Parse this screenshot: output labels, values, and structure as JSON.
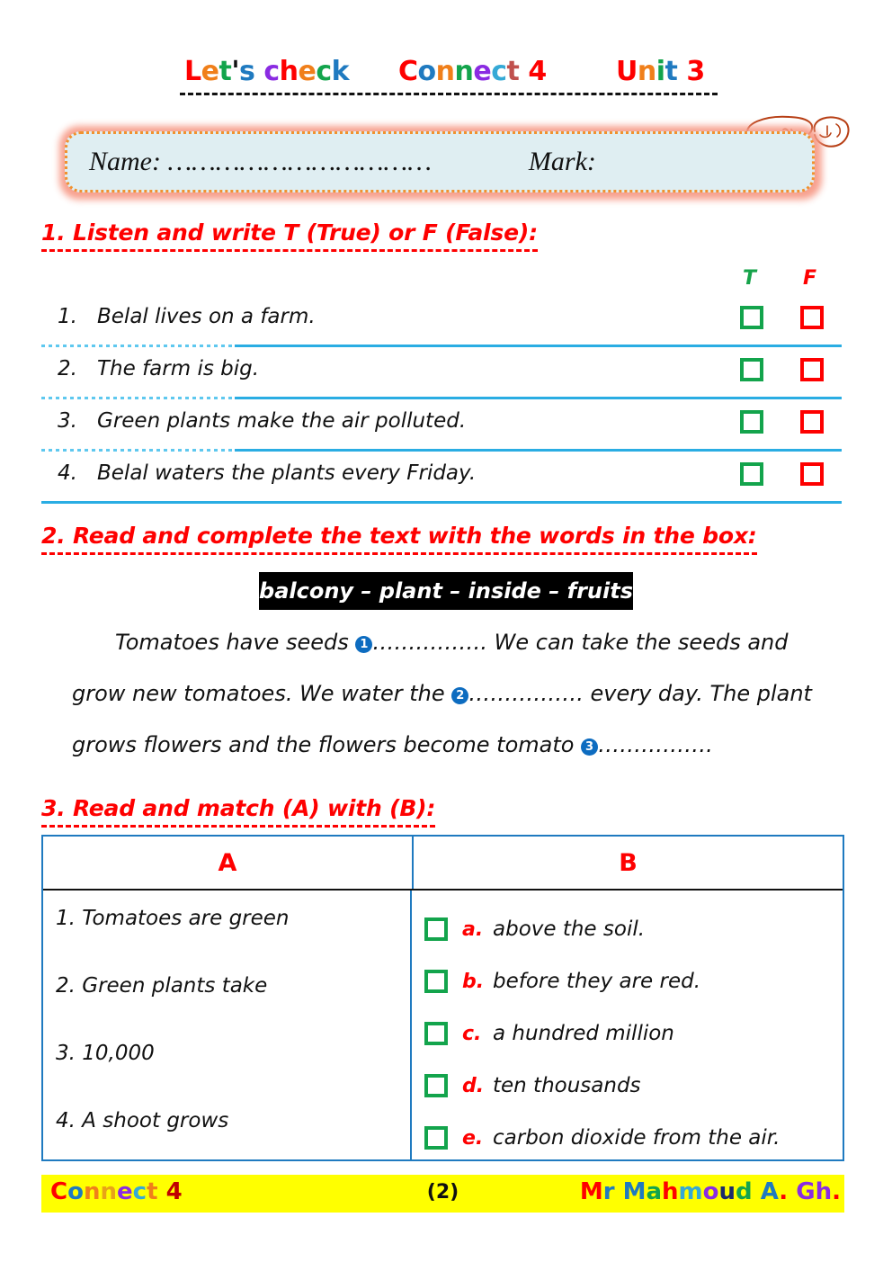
{
  "header": {
    "titles": [
      {
        "text": "Let's check",
        "letters": [
          {
            "c": "L",
            "color": "#fe0000"
          },
          {
            "c": "e",
            "color": "#f07f1a"
          },
          {
            "c": "t",
            "color": "#13a44c"
          },
          {
            "c": "'",
            "color": "#111111"
          },
          {
            "c": "s",
            "color": "#1f7ac0"
          },
          {
            "c": " ",
            "color": "#111111"
          },
          {
            "c": "c",
            "color": "#8a2be2"
          },
          {
            "c": "h",
            "color": "#fe0000"
          },
          {
            "c": "e",
            "color": "#f07f1a"
          },
          {
            "c": "c",
            "color": "#13a44c"
          },
          {
            "c": "k",
            "color": "#1f7ac0"
          }
        ]
      },
      {
        "text": "Connect 4",
        "letters": [
          {
            "c": "C",
            "color": "#fe0000"
          },
          {
            "c": "o",
            "color": "#1f7ac0"
          },
          {
            "c": "n",
            "color": "#f07f1a"
          },
          {
            "c": "n",
            "color": "#13a44c"
          },
          {
            "c": "e",
            "color": "#8a2be2"
          },
          {
            "c": "c",
            "color": "#35a9d6"
          },
          {
            "c": "t",
            "color": "#c0504d"
          },
          {
            "c": " ",
            "color": "#111111"
          },
          {
            "c": "4",
            "color": "#fe0000"
          }
        ]
      },
      {
        "text": "Unit 3",
        "letters": [
          {
            "c": "U",
            "color": "#fe0000"
          },
          {
            "c": "n",
            "color": "#f07f1a"
          },
          {
            "c": "i",
            "color": "#13a44c"
          },
          {
            "c": "t",
            "color": "#1f7ac0"
          },
          {
            "c": " ",
            "color": "#111111"
          },
          {
            "c": "3",
            "color": "#fe0000"
          }
        ]
      }
    ],
    "signature_label": "Arabic teacher signature"
  },
  "name_box": {
    "name_label": "Name: ……………………………",
    "mark_label": "Mark:",
    "fill_color": "#dfeef2",
    "border_color": "#f0922f",
    "glow_color": "#f79b88"
  },
  "section1": {
    "heading": "1. Listen and write T (True) or F (False):",
    "col_true": "T",
    "col_false": "F",
    "true_color": "#16a34a",
    "false_color": "#fe0000",
    "items": [
      {
        "num": "1.",
        "text": "Belal lives on a farm."
      },
      {
        "num": "2.",
        "text": "The farm is big."
      },
      {
        "num": "3.",
        "text": "Green plants make the air polluted."
      },
      {
        "num": "4.",
        "text": "Belal waters the plants every Friday."
      }
    ]
  },
  "section2": {
    "heading": "2. Read and complete the text with the words in the box:",
    "word_box": "balcony – plant – inside – fruits",
    "word_box_words": [
      "balcony",
      "plant",
      "inside",
      "fruits"
    ],
    "paragraph_parts": {
      "p1": "Tomatoes have seeds ",
      "n1": "1",
      "p2": "……………. We can take the seeds and grow new tomatoes. We water the ",
      "n2": "2",
      "p3": "……………. every day. The plant grows flowers and the flowers become tomato ",
      "n3": "3",
      "p4": "……………."
    },
    "bullet_color": "#0d6cc0"
  },
  "section3": {
    "heading": "3. Read and match (A) with (B):",
    "col_a_header": "A",
    "col_b_header": "B",
    "col_a_items": [
      "1. Tomatoes are green",
      "2. Green plants take",
      "3. 10,000",
      "4. A shoot grows"
    ],
    "col_b_items": [
      {
        "letter": "a.",
        "text": "above the soil."
      },
      {
        "letter": "b.",
        "text": "before they are red."
      },
      {
        "letter": "c.",
        "text": "a hundred million"
      },
      {
        "letter": "d.",
        "text": "ten thousands"
      },
      {
        "letter": "e.",
        "text": "carbon dioxide from the air."
      }
    ],
    "checkbox_color": "#13a44c",
    "table_border_color": "#1f7ac0"
  },
  "footer": {
    "background": "#ffff00",
    "page_number": "(2)",
    "left": {
      "text": "Connect 4",
      "letters": [
        {
          "c": "C",
          "color": "#fe0000"
        },
        {
          "c": "o",
          "color": "#1f7ac0"
        },
        {
          "c": "n",
          "color": "#f07f1a"
        },
        {
          "c": "n",
          "color": "#e8a317"
        },
        {
          "c": "e",
          "color": "#8a2be2"
        },
        {
          "c": "c",
          "color": "#35a9d6"
        },
        {
          "c": "t",
          "color": "#f07f1a"
        },
        {
          "c": " ",
          "color": "#111111"
        },
        {
          "c": "4",
          "color": "#c00000"
        }
      ]
    },
    "right": {
      "text": "Mr Mahmoud A. Gh.",
      "letters": [
        {
          "c": "M",
          "color": "#fe0000"
        },
        {
          "c": "r",
          "color": "#1f7ac0"
        },
        {
          "c": " ",
          "color": "#111111"
        },
        {
          "c": "M",
          "color": "#1f7ac0"
        },
        {
          "c": "a",
          "color": "#13a44c"
        },
        {
          "c": "h",
          "color": "#fe0000"
        },
        {
          "c": "m",
          "color": "#35a9d6"
        },
        {
          "c": "o",
          "color": "#8a2be2"
        },
        {
          "c": "u",
          "color": "#1b2a6b"
        },
        {
          "c": "d",
          "color": "#13a44c"
        },
        {
          "c": " ",
          "color": "#111111"
        },
        {
          "c": "A",
          "color": "#1f7ac0"
        },
        {
          "c": ".",
          "color": "#fe0000"
        },
        {
          "c": " ",
          "color": "#111111"
        },
        {
          "c": "G",
          "color": "#8a2be2"
        },
        {
          "c": "h",
          "color": "#8a2be2"
        },
        {
          "c": ".",
          "color": "#fe0000"
        }
      ]
    }
  }
}
